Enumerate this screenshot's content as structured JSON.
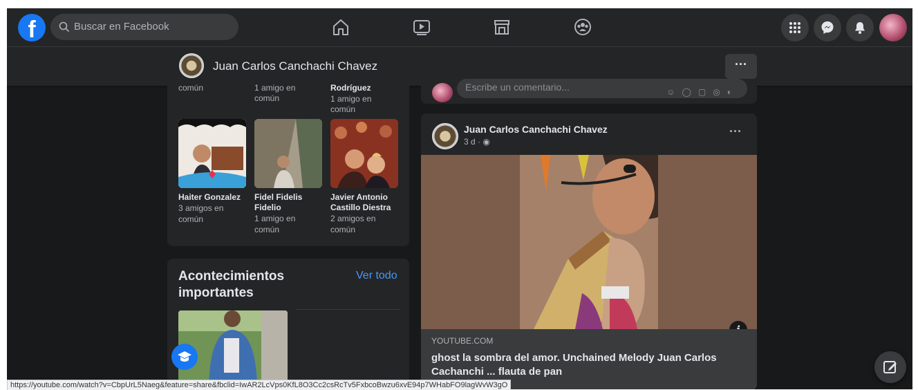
{
  "topbar": {
    "logo": "f",
    "search_placeholder": "Buscar en Facebook",
    "nav_icons": [
      "home-icon",
      "watch-icon",
      "marketplace-icon",
      "groups-icon"
    ],
    "right_icons": [
      "menu-grid-icon",
      "messenger-icon",
      "notifications-icon"
    ]
  },
  "profile_bar": {
    "name": "Juan Carlos Canchachi Chavez",
    "more": "···"
  },
  "friends": {
    "top_row": [
      {
        "mutual": "común"
      },
      {
        "mutual": "1 amigo en común"
      },
      {
        "name_tail": "Rodríguez",
        "mutual": "1 amigo en común"
      }
    ],
    "items": [
      {
        "name": "Haiter Gonzalez",
        "mutual": "3 amigos en común"
      },
      {
        "name": "Fidel Fidelis Fidelio",
        "mutual": "1 amigo en común"
      },
      {
        "name": "Javier Antonio Castillo Diestra",
        "mutual": "2 amigos en común"
      }
    ]
  },
  "events": {
    "title": "Acontecimientos importantes",
    "see_all": "Ver todo"
  },
  "comment": {
    "placeholder": "Escribe un comentario..."
  },
  "post": {
    "author": "Juan Carlos Canchachi Chavez",
    "time": "3 d · ",
    "more": "···",
    "info": "i",
    "link_domain": "YOUTUBE.COM",
    "link_title": "ghost la sombra del amor. Unchained Melody Juan Carlos Cachanchi ... flauta de pan"
  },
  "status_url": "https://youtube.com/watch?v=CbpUrL5Naeg&feature=share&fbclid=IwAR2LcVps0KfL8O3Cc2csRcTv5FxbcoBwzu6xvE94p7WHabFO9lagWvW3gO",
  "colors": {
    "background": "#18191a",
    "surface": "#242526",
    "accent": "#1877f2",
    "link": "#4599ff"
  }
}
